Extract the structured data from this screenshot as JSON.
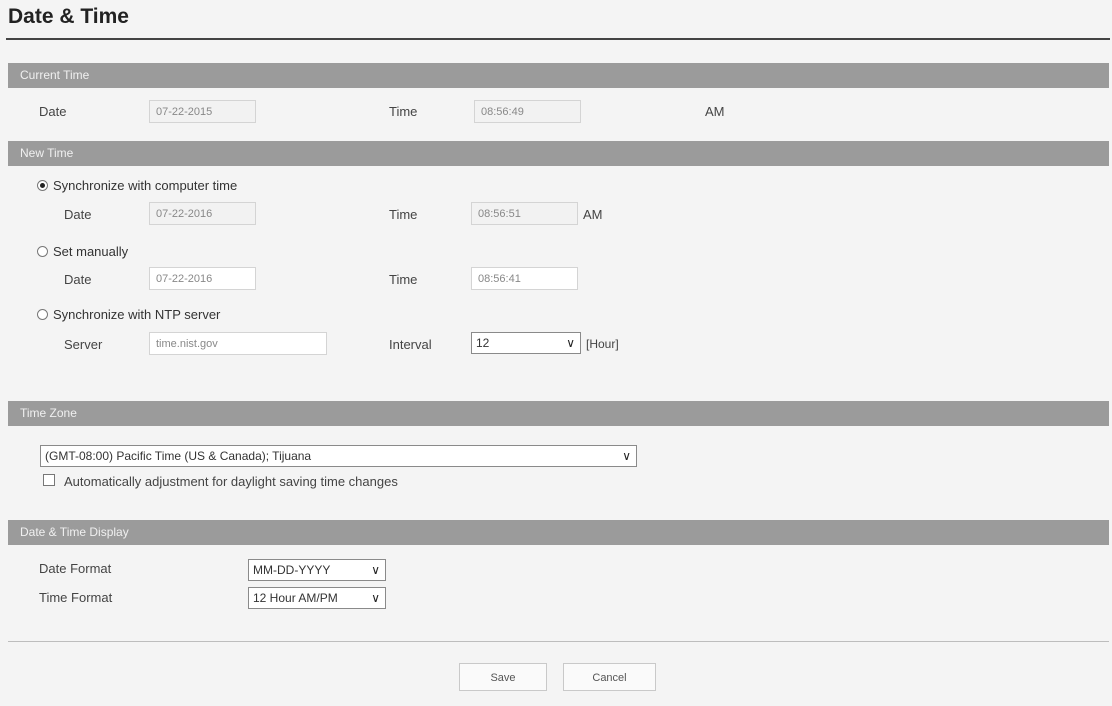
{
  "page": {
    "title": "Date & Time"
  },
  "current_time": {
    "header": "Current Time",
    "date_label": "Date",
    "date_value": "07-22-2015",
    "time_label": "Time",
    "time_value": "08:56:49",
    "ampm": "AM"
  },
  "new_time": {
    "header": "New Time",
    "sync_computer": {
      "label": "Synchronize with computer time",
      "selected": true,
      "date_label": "Date",
      "date_value": "07-22-2016",
      "time_label": "Time",
      "time_value": "08:56:51",
      "ampm": "AM"
    },
    "manual": {
      "label": "Set manually",
      "selected": false,
      "date_label": "Date",
      "date_value": "07-22-2016",
      "time_label": "Time",
      "time_value": "08:56:41"
    },
    "ntp": {
      "label": "Synchronize with NTP server",
      "selected": false,
      "server_label": "Server",
      "server_value": "time.nist.gov",
      "interval_label": "Interval",
      "interval_value": "12",
      "interval_unit": "[Hour]"
    }
  },
  "time_zone": {
    "header": "Time Zone",
    "selected": "(GMT-08:00) Pacific Time (US & Canada); Tijuana",
    "dst_label": "Automatically adjustment for daylight saving time changes",
    "dst_checked": false
  },
  "display": {
    "header": "Date & Time Display",
    "date_format_label": "Date Format",
    "date_format_value": "MM-DD-YYYY",
    "time_format_label": "Time Format",
    "time_format_value": "12 Hour AM/PM"
  },
  "buttons": {
    "save": "Save",
    "cancel": "Cancel"
  },
  "icons": {
    "dropdown": "chevron-down-icon"
  }
}
